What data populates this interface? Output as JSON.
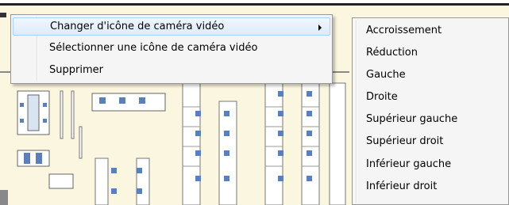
{
  "context_menu": {
    "items": [
      {
        "label": "Changer d'icône de caméra vidéo",
        "has_submenu": true,
        "highlighted": true
      },
      {
        "label": "Sélectionner une icône de caméra vidéo",
        "has_submenu": false,
        "highlighted": false
      },
      {
        "label": "Supprimer",
        "has_submenu": false,
        "highlighted": false
      }
    ]
  },
  "submenu": {
    "items": [
      {
        "label": "Accroissement"
      },
      {
        "label": "Réduction"
      },
      {
        "label": "Gauche"
      },
      {
        "label": "Droite"
      },
      {
        "label": "Supérieur gauche"
      },
      {
        "label": "Supérieur droit"
      },
      {
        "label": "Inférieur gauche"
      },
      {
        "label": "Inférieur droit"
      }
    ]
  },
  "colors": {
    "floor": "#fbf6df",
    "menu_bg": "#f5f5f5",
    "highlight_border": "#aecff7",
    "desk": "#ffffff",
    "chair": "#5b7fb8"
  }
}
